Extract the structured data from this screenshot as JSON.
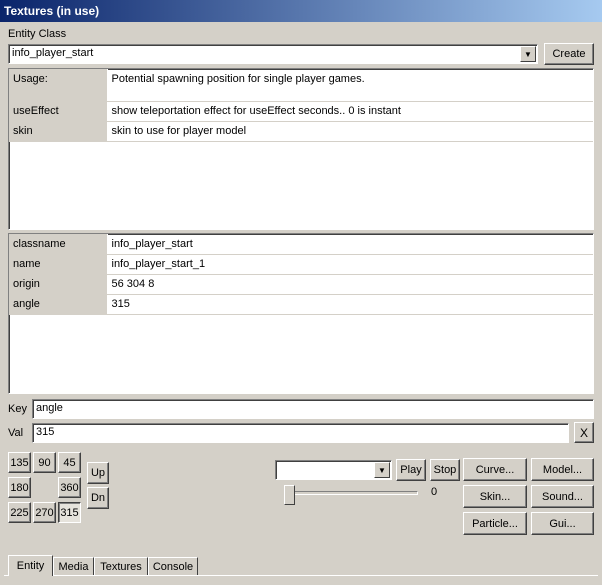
{
  "window": {
    "title": "Textures (in use)"
  },
  "entity_class": {
    "label": "Entity Class",
    "selected": "info_player_start",
    "create_label": "Create"
  },
  "help": {
    "rows": [
      {
        "key": "Usage:",
        "value": "Potential spawning position for single player games."
      },
      {
        "key": "useEffect",
        "value": "show teleportation effect for useEffect seconds.. 0 is instant"
      },
      {
        "key": "skin",
        "value": "skin to use for player model"
      }
    ]
  },
  "properties": {
    "rows": [
      {
        "key": "classname",
        "value": "info_player_start"
      },
      {
        "key": "name",
        "value": "info_player_start_1"
      },
      {
        "key": "origin",
        "value": "56 304 8"
      },
      {
        "key": "angle",
        "value": "315"
      }
    ]
  },
  "editor": {
    "key_label": "Key",
    "key_value": "angle",
    "val_label": "Val",
    "val_value": "315",
    "clear_label": "X"
  },
  "angles": {
    "buttons": [
      "135",
      "90",
      "45",
      "180",
      "360",
      "225",
      "270",
      "315"
    ],
    "selected": "315",
    "up_label": "Up",
    "down_label": "Dn"
  },
  "sound": {
    "selected": "",
    "play_label": "Play",
    "stop_label": "Stop",
    "volume_value": "0",
    "volume_level": 0
  },
  "actions": {
    "curve": "Curve...",
    "model": "Model...",
    "skin": "Skin...",
    "sound": "Sound...",
    "particle": "Particle...",
    "gui": "Gui..."
  },
  "tabs": [
    "Entity",
    "Media",
    "Textures",
    "Console"
  ],
  "active_tab": "Entity"
}
